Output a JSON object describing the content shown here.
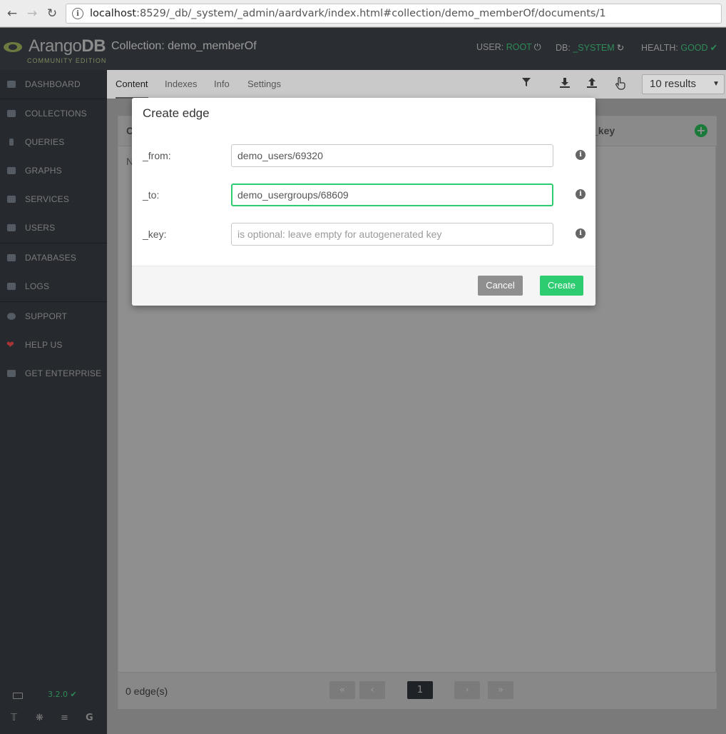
{
  "browser": {
    "url_host": "localhost",
    "url_rest": ":8529/_db/_system/_admin/aardvark/index.html#collection/demo_memberOf/documents/1"
  },
  "header": {
    "logo_text_a": "Arango",
    "logo_text_b": "DB",
    "logo_edition": "COMMUNITY EDITION",
    "collection_title": "Collection: demo_memberOf",
    "user_label": "USER:",
    "user_value": "ROOT",
    "db_label": "DB:",
    "db_value": "_SYSTEM",
    "health_label": "HEALTH:",
    "health_value": "GOOD",
    "accent_color": "#2ecc71"
  },
  "sidebar": {
    "items": [
      {
        "label": "DASHBOARD",
        "icon": "dashboard-icon"
      },
      {
        "label": "COLLECTIONS",
        "icon": "folder-icon"
      },
      {
        "label": "QUERIES",
        "icon": "bolt-icon"
      },
      {
        "label": "GRAPHS",
        "icon": "chart-icon"
      },
      {
        "label": "SERVICES",
        "icon": "cogs-icon"
      },
      {
        "label": "USERS",
        "icon": "users-icon"
      },
      {
        "label": "DATABASES",
        "icon": "database-icon"
      },
      {
        "label": "LOGS",
        "icon": "file-icon"
      },
      {
        "label": "SUPPORT",
        "icon": "lifebuoy-icon"
      },
      {
        "label": "HELP US",
        "icon": "heart-icon"
      },
      {
        "label": "GET ENTERPRISE",
        "icon": "enterprise-icon"
      }
    ],
    "version": "3.2.0",
    "social_icons": [
      "twitter-icon",
      "slack-icon",
      "stackoverflow-icon",
      "google-icon"
    ]
  },
  "subnav": {
    "tabs": [
      "Content",
      "Indexes",
      "Info",
      "Settings"
    ],
    "active_tab": "Content",
    "results_select": "10 results"
  },
  "documents": {
    "header_c": "C",
    "header_key": "_key",
    "empty_text": "N",
    "count_text": "0 edge(s)",
    "current_page": "1"
  },
  "modal": {
    "title": "Create edge",
    "from_label": "_from:",
    "from_value": "demo_users/69320",
    "to_label": "_to:",
    "to_value": "demo_usergroups/68609",
    "key_label": "_key:",
    "key_placeholder": "is optional: leave empty for autogenerated key",
    "cancel_label": "Cancel",
    "create_label": "Create",
    "create_color": "#2ecc71",
    "cancel_color": "#8f8f8f"
  }
}
